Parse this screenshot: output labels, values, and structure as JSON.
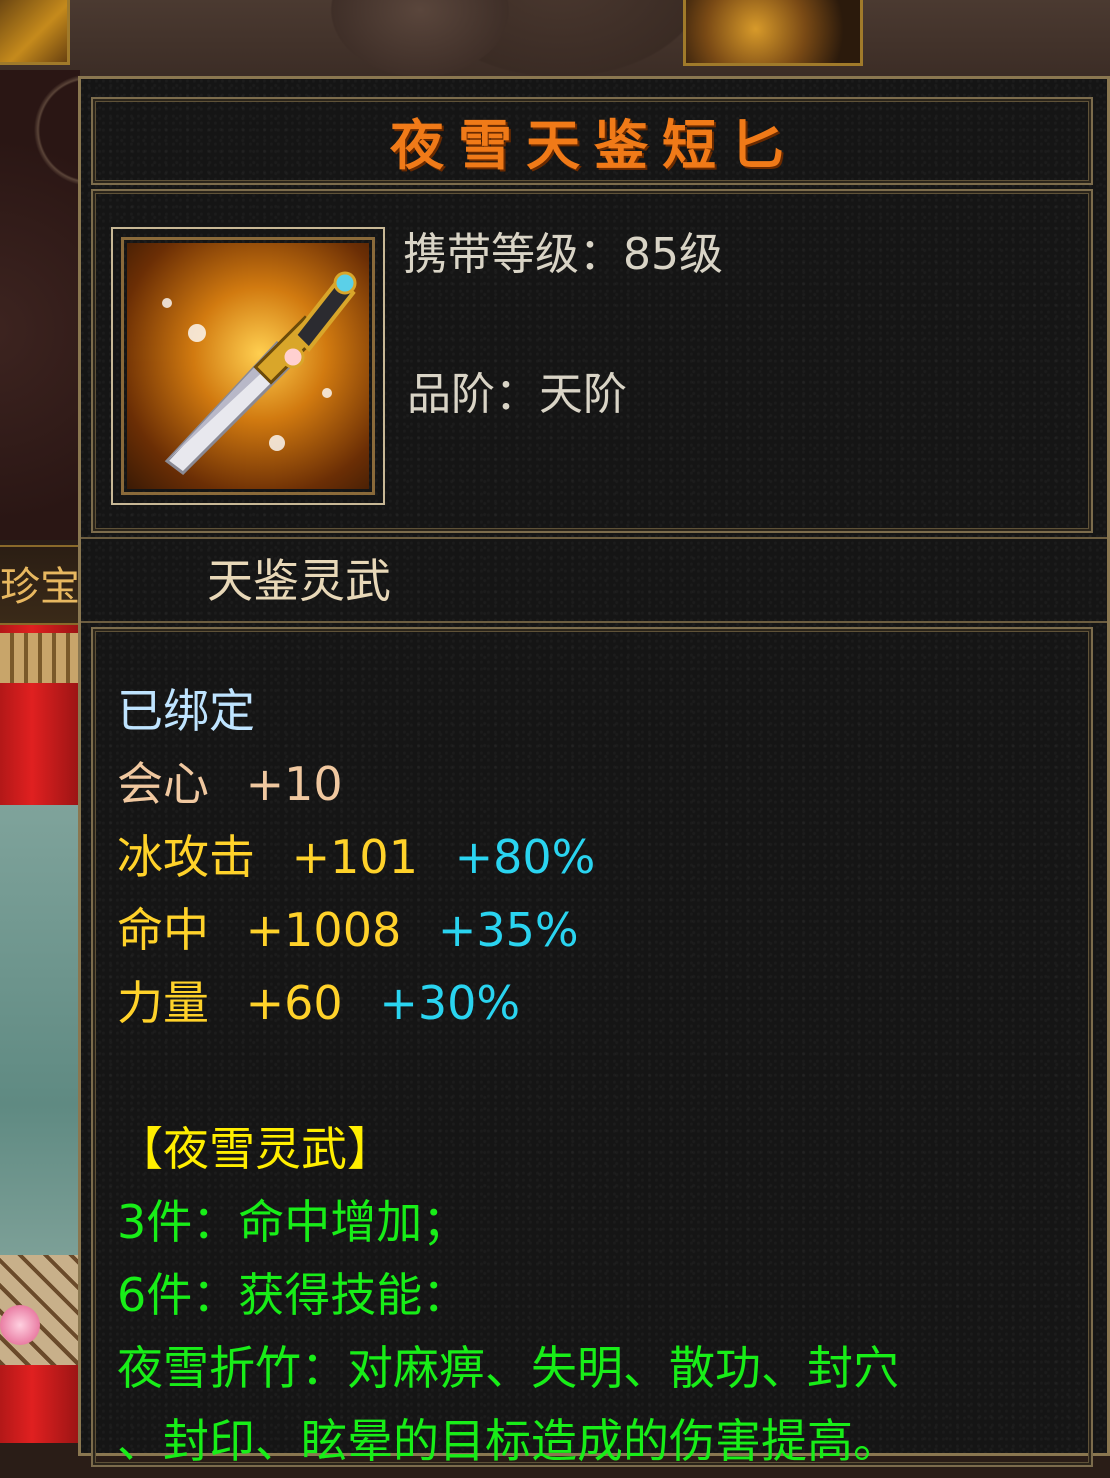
{
  "item": {
    "name": "夜雪天鉴短匕",
    "carry_level": "携带等级：85级",
    "grade": "品阶：天阶",
    "category": "天鉴灵武",
    "icon": "dagger-icon"
  },
  "background": {
    "left_tab_text": "珍宝"
  },
  "attributes": {
    "bound": "已绑定",
    "stats": [
      {
        "name": "会心",
        "value": "+10",
        "bonus": ""
      },
      {
        "name": "冰攻击",
        "value": "+101",
        "bonus": "+80%"
      },
      {
        "name": "命中",
        "value": "+1008",
        "bonus": "+35%"
      },
      {
        "name": "力量",
        "value": "+60",
        "bonus": "+30%"
      }
    ]
  },
  "set": {
    "title": "【夜雪灵武】",
    "bonus3": "3件：命中增加；",
    "bonus6": "6件：获得技能：",
    "skill_line1": "夜雪折竹：对麻痹、失明、散功、封穴",
    "skill_line2": "、封印、眩晕的目标造成的伤害提高。"
  },
  "colors": {
    "title": "#f07a18",
    "stat_name_gold": "#ffd22a",
    "stat_name_peach": "#f0c8a0",
    "bonus_cyan": "#2ad4f0",
    "set_title": "#ffee00",
    "set_text": "#18ee18",
    "bound": "#bfe4ff"
  }
}
